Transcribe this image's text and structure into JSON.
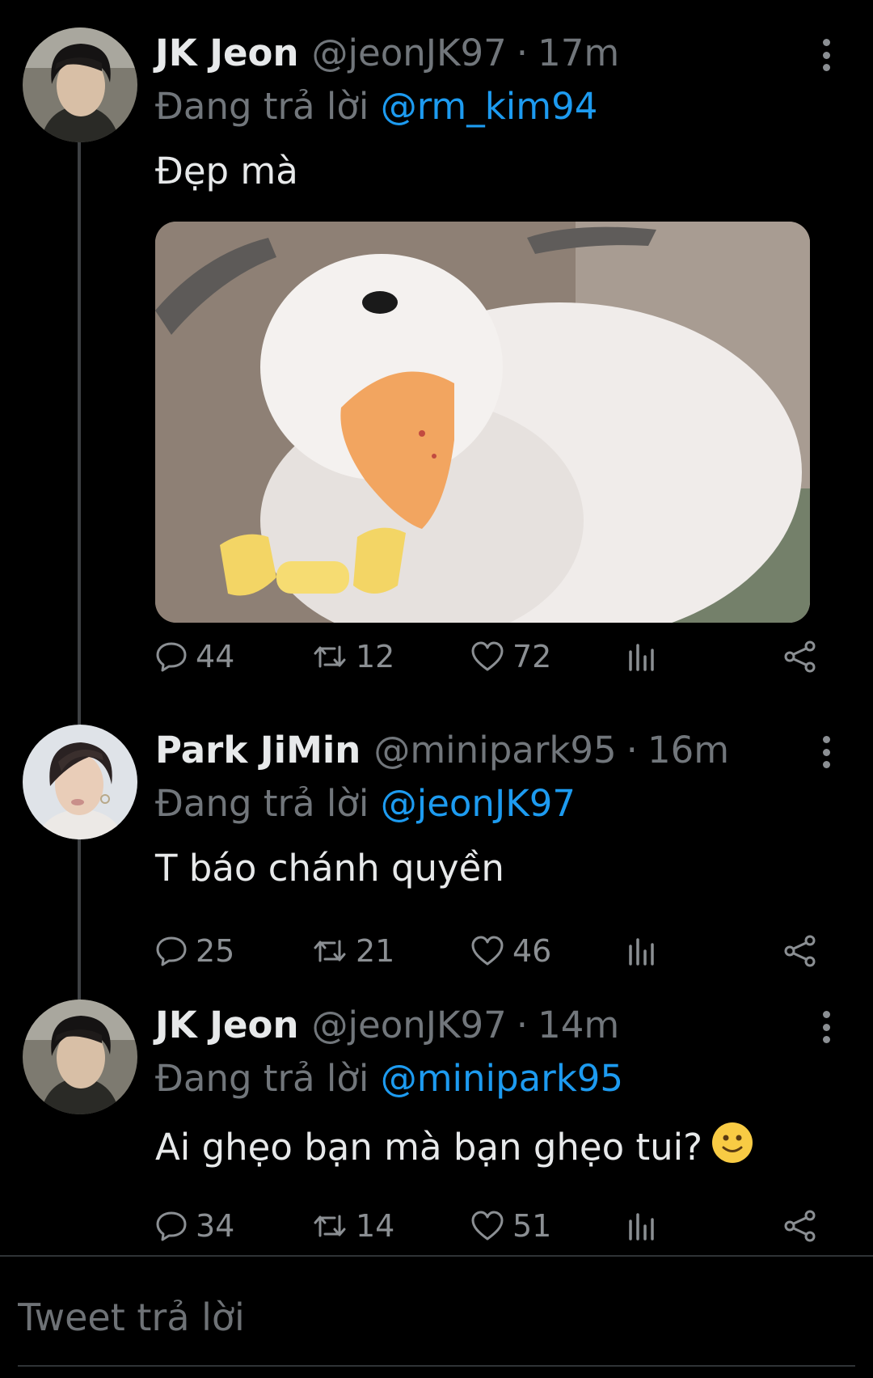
{
  "tweets": [
    {
      "display_name": "JK Jeon",
      "handle": "@jeonJK97",
      "separator": "·",
      "time": "17m",
      "replying_prefix": "Đang trả lời ",
      "replying_to": "@rm_kim94",
      "text": "Đẹp mà",
      "media": "duck-photo",
      "stats": {
        "replies": "44",
        "retweets": "12",
        "likes": "72"
      }
    },
    {
      "display_name": "Park JiMin",
      "handle": "@minipark95",
      "separator": "·",
      "time": "16m",
      "replying_prefix": "Đang trả lời ",
      "replying_to": "@jeonJK97",
      "text": "T báo chánh quyền",
      "stats": {
        "replies": "25",
        "retweets": "21",
        "likes": "46"
      }
    },
    {
      "display_name": "JK Jeon",
      "handle": "@jeonJK97",
      "separator": "·",
      "time": "14m",
      "replying_prefix": "Đang trả lời ",
      "replying_to": "@minipark95",
      "text": "Ai ghẹo bạn mà bạn ghẹo tui?",
      "emoji": "slight-smile-emoji",
      "stats": {
        "replies": "34",
        "retweets": "14",
        "likes": "51"
      }
    }
  ],
  "reply_box": {
    "placeholder": "Tweet trả lời"
  },
  "icons": [
    "reply-icon",
    "retweet-icon",
    "like-icon",
    "analytics-icon",
    "share-icon",
    "more-icon"
  ],
  "colors": {
    "background": "#000000",
    "text": "#e7e9ea",
    "muted": "#71767b",
    "mention": "#1d9bf0",
    "thread_line": "#3e4144"
  }
}
